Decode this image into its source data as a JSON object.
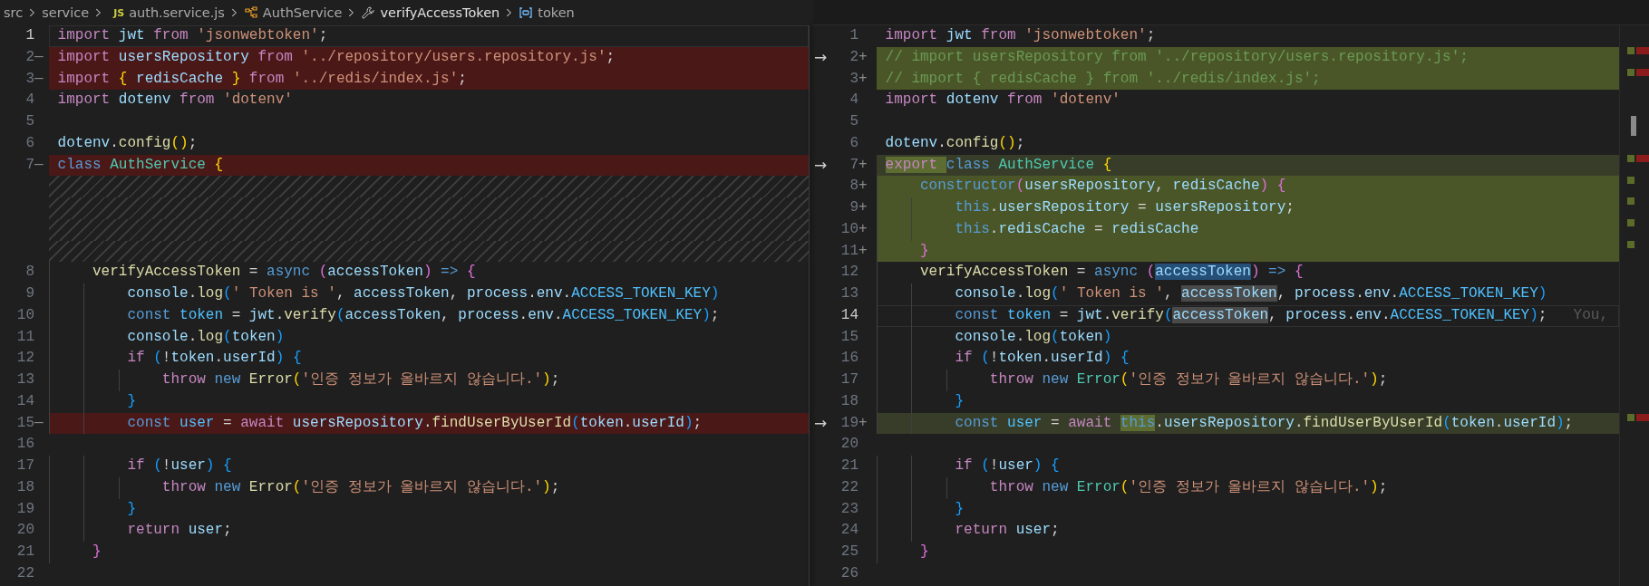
{
  "breadcrumb": [
    {
      "kind": "folder",
      "text": "src"
    },
    {
      "kind": "folder",
      "text": "service"
    },
    {
      "kind": "file",
      "badge": "JS",
      "text": "auth.service.js"
    },
    {
      "kind": "class",
      "text": "AuthService"
    },
    {
      "kind": "method",
      "text": "verifyAccessToken"
    },
    {
      "kind": "variable",
      "text": "token"
    }
  ],
  "panes": [
    {
      "kind": "original",
      "lines": [
        {
          "number": "1",
          "kind": "none",
          "current": true,
          "tokens": [
            {
              "text": "import ",
              "kind": "keyword"
            },
            {
              "text": "jwt ",
              "kind": "variable"
            },
            {
              "text": "from ",
              "kind": "keyword"
            },
            {
              "text": "'jsonwebtoken'",
              "kind": "string"
            },
            {
              "text": ";",
              "kind": "plain"
            }
          ]
        },
        {
          "number": "2",
          "marker": "—",
          "kind": "removed",
          "current": false,
          "tokens": [
            {
              "text": "import ",
              "kind": "keyword"
            },
            {
              "text": "usersRepository ",
              "kind": "variable"
            },
            {
              "text": "from ",
              "kind": "keyword"
            },
            {
              "text": "'../repository/users.repository.js'",
              "kind": "string"
            },
            {
              "text": ";",
              "kind": "plain"
            }
          ]
        },
        {
          "number": "3",
          "marker": "—",
          "kind": "removed",
          "current": false,
          "tokens": [
            {
              "text": "import ",
              "kind": "keyword"
            },
            {
              "text": "{ ",
              "kind": "bracket1"
            },
            {
              "text": "redisCache ",
              "kind": "variable"
            },
            {
              "text": "} ",
              "kind": "bracket1"
            },
            {
              "text": "from ",
              "kind": "keyword"
            },
            {
              "text": "'../redis/index.js'",
              "kind": "string"
            },
            {
              "text": ";",
              "kind": "plain"
            }
          ]
        },
        {
          "number": "4",
          "kind": "none",
          "current": false,
          "tokens": [
            {
              "text": "import ",
              "kind": "keyword"
            },
            {
              "text": "dotenv ",
              "kind": "variable"
            },
            {
              "text": "from ",
              "kind": "keyword"
            },
            {
              "text": "'dotenv'",
              "kind": "string"
            }
          ]
        },
        {
          "number": "5",
          "kind": "none",
          "current": false
        },
        {
          "number": "6",
          "kind": "none",
          "current": false,
          "tokens": [
            {
              "text": "dotenv",
              "kind": "variable"
            },
            {
              "text": ".",
              "kind": "plain"
            },
            {
              "text": "config",
              "kind": "function"
            },
            {
              "text": "()",
              "kind": "bracket1"
            },
            {
              "text": ";",
              "kind": "plain"
            }
          ]
        },
        {
          "number": "7",
          "marker": "—",
          "kind": "removed",
          "current": false,
          "tokens": [
            {
              "text": "class ",
              "kind": "storage"
            },
            {
              "text": "AuthService ",
              "kind": "type"
            },
            {
              "text": "{",
              "kind": "bracket1"
            }
          ]
        },
        {
          "kind": "filler"
        },
        {
          "kind": "filler"
        },
        {
          "kind": "filler"
        },
        {
          "kind": "filler"
        },
        {
          "number": "8",
          "kind": "none",
          "current": false,
          "tokens": [
            {
              "text": "    verifyAccessToken ",
              "kind": "function"
            },
            {
              "text": "= ",
              "kind": "plain"
            },
            {
              "text": "async ",
              "kind": "storage"
            },
            {
              "text": "(",
              "kind": "bracket2"
            },
            {
              "text": "accessToken",
              "kind": "variable"
            },
            {
              "text": ") ",
              "kind": "bracket2"
            },
            {
              "text": "=> ",
              "kind": "storage"
            },
            {
              "text": "{",
              "kind": "bracket2"
            }
          ]
        },
        {
          "number": "9",
          "kind": "none",
          "current": false,
          "tokens": [
            {
              "text": "        console",
              "kind": "variable"
            },
            {
              "text": ".",
              "kind": "plain"
            },
            {
              "text": "log",
              "kind": "function"
            },
            {
              "text": "(",
              "kind": "bracket3"
            },
            {
              "text": "' Token is '",
              "kind": "string"
            },
            {
              "text": ", ",
              "kind": "plain"
            },
            {
              "text": "accessToken",
              "kind": "variable"
            },
            {
              "text": ", ",
              "kind": "plain"
            },
            {
              "text": "process",
              "kind": "variable"
            },
            {
              "text": ".",
              "kind": "plain"
            },
            {
              "text": "env",
              "kind": "variable"
            },
            {
              "text": ".",
              "kind": "plain"
            },
            {
              "text": "ACCESS_TOKEN_KEY",
              "kind": "constant"
            },
            {
              "text": ")",
              "kind": "bracket3"
            }
          ]
        },
        {
          "number": "10",
          "kind": "none",
          "current": false,
          "tokens": [
            {
              "text": "        const ",
              "kind": "storage"
            },
            {
              "text": "token ",
              "kind": "constant"
            },
            {
              "text": "= ",
              "kind": "plain"
            },
            {
              "text": "jwt",
              "kind": "variable"
            },
            {
              "text": ".",
              "kind": "plain"
            },
            {
              "text": "verify",
              "kind": "function"
            },
            {
              "text": "(",
              "kind": "bracket3"
            },
            {
              "text": "accessToken",
              "kind": "variable"
            },
            {
              "text": ", ",
              "kind": "plain"
            },
            {
              "text": "process",
              "kind": "variable"
            },
            {
              "text": ".",
              "kind": "plain"
            },
            {
              "text": "env",
              "kind": "variable"
            },
            {
              "text": ".",
              "kind": "plain"
            },
            {
              "text": "ACCESS_TOKEN_KEY",
              "kind": "constant"
            },
            {
              "text": ")",
              "kind": "bracket3"
            },
            {
              "text": ";",
              "kind": "plain"
            }
          ]
        },
        {
          "number": "11",
          "kind": "none",
          "current": false,
          "tokens": [
            {
              "text": "        console",
              "kind": "variable"
            },
            {
              "text": ".",
              "kind": "plain"
            },
            {
              "text": "log",
              "kind": "function"
            },
            {
              "text": "(",
              "kind": "bracket3"
            },
            {
              "text": "token",
              "kind": "variable"
            },
            {
              "text": ")",
              "kind": "bracket3"
            }
          ]
        },
        {
          "number": "12",
          "kind": "none",
          "current": false,
          "tokens": [
            {
              "text": "        if ",
              "kind": "keyword"
            },
            {
              "text": "(",
              "kind": "bracket3"
            },
            {
              "text": "!",
              "kind": "plain"
            },
            {
              "text": "token",
              "kind": "variable"
            },
            {
              "text": ".",
              "kind": "plain"
            },
            {
              "text": "userId",
              "kind": "variable"
            },
            {
              "text": ") ",
              "kind": "bracket3"
            },
            {
              "text": "{",
              "kind": "bracket3"
            }
          ]
        },
        {
          "number": "13",
          "kind": "none",
          "current": false,
          "tokens": [
            {
              "text": "            throw ",
              "kind": "keyword"
            },
            {
              "text": "new ",
              "kind": "storage"
            },
            {
              "text": "Error",
              "kind": "function"
            },
            {
              "text": "(",
              "kind": "bracket1"
            },
            {
              "text": "'인증 정보가 올바르지 않습니다.'",
              "kind": "string"
            },
            {
              "text": ")",
              "kind": "bracket1"
            },
            {
              "text": ";",
              "kind": "plain"
            }
          ]
        },
        {
          "number": "14",
          "kind": "none",
          "current": false,
          "tokens": [
            {
              "text": "        }",
              "kind": "bracket3"
            }
          ]
        },
        {
          "number": "15",
          "marker": "—",
          "kind": "removed",
          "current": false,
          "tokens": [
            {
              "text": "        const ",
              "kind": "storage"
            },
            {
              "text": "user ",
              "kind": "constant"
            },
            {
              "text": "= ",
              "kind": "plain"
            },
            {
              "text": "await ",
              "kind": "keyword"
            },
            {
              "text": "usersRepository",
              "kind": "variable"
            },
            {
              "text": ".",
              "kind": "plain"
            },
            {
              "text": "findUserByUserId",
              "kind": "function"
            },
            {
              "text": "(",
              "kind": "bracket3"
            },
            {
              "text": "token",
              "kind": "variable"
            },
            {
              "text": ".",
              "kind": "plain"
            },
            {
              "text": "userId",
              "kind": "variable"
            },
            {
              "text": ")",
              "kind": "bracket3"
            },
            {
              "text": ";",
              "kind": "plain"
            }
          ]
        },
        {
          "number": "16",
          "kind": "none",
          "current": false
        },
        {
          "number": "17",
          "kind": "none",
          "current": false,
          "tokens": [
            {
              "text": "        if ",
              "kind": "keyword"
            },
            {
              "text": "(",
              "kind": "bracket3"
            },
            {
              "text": "!",
              "kind": "plain"
            },
            {
              "text": "user",
              "kind": "variable"
            },
            {
              "text": ") ",
              "kind": "bracket3"
            },
            {
              "text": "{",
              "kind": "bracket3"
            }
          ]
        },
        {
          "number": "18",
          "kind": "none",
          "current": false,
          "tokens": [
            {
              "text": "            throw ",
              "kind": "keyword"
            },
            {
              "text": "new ",
              "kind": "storage"
            },
            {
              "text": "Error",
              "kind": "function"
            },
            {
              "text": "(",
              "kind": "bracket1"
            },
            {
              "text": "'인증 정보가 올바르지 않습니다.'",
              "kind": "string"
            },
            {
              "text": ")",
              "kind": "bracket1"
            },
            {
              "text": ";",
              "kind": "plain"
            }
          ]
        },
        {
          "number": "19",
          "kind": "none",
          "current": false,
          "tokens": [
            {
              "text": "        }",
              "kind": "bracket3"
            }
          ]
        },
        {
          "number": "20",
          "kind": "none",
          "current": false,
          "tokens": [
            {
              "text": "        return ",
              "kind": "keyword"
            },
            {
              "text": "user",
              "kind": "variable"
            },
            {
              "text": ";",
              "kind": "plain"
            }
          ]
        },
        {
          "number": "21",
          "kind": "none",
          "current": false,
          "tokens": [
            {
              "text": "    }",
              "kind": "bracket2"
            }
          ]
        },
        {
          "number": "22",
          "kind": "none",
          "current": false
        }
      ]
    },
    {
      "kind": "modified",
      "lines": [
        {
          "number": "1",
          "kind": "none",
          "current": false,
          "tokens": [
            {
              "text": "import ",
              "kind": "keyword"
            },
            {
              "text": "jwt ",
              "kind": "variable"
            },
            {
              "text": "from ",
              "kind": "keyword"
            },
            {
              "text": "'jsonwebtoken'",
              "kind": "string"
            },
            {
              "text": ";",
              "kind": "plain"
            }
          ]
        },
        {
          "number": "2",
          "marker": "+",
          "arrow": "→",
          "kind": "added",
          "current": false,
          "tokens": [
            {
              "text": "// import usersRepository from '../repository/users.repository.js';",
              "kind": "comment"
            }
          ]
        },
        {
          "number": "3",
          "marker": "+",
          "kind": "added",
          "current": false,
          "tokens": [
            {
              "text": "// import { redisCache } from '../redis/index.js';",
              "kind": "comment"
            }
          ]
        },
        {
          "number": "4",
          "kind": "none",
          "current": false,
          "tokens": [
            {
              "text": "import ",
              "kind": "keyword"
            },
            {
              "text": "dotenv ",
              "kind": "variable"
            },
            {
              "text": "from ",
              "kind": "keyword"
            },
            {
              "text": "'dotenv'",
              "kind": "string"
            }
          ]
        },
        {
          "number": "5",
          "kind": "none",
          "current": false
        },
        {
          "number": "6",
          "kind": "none",
          "current": false,
          "tokens": [
            {
              "text": "dotenv",
              "kind": "variable"
            },
            {
              "text": ".",
              "kind": "plain"
            },
            {
              "text": "config",
              "kind": "function"
            },
            {
              "text": "()",
              "kind": "bracket1"
            },
            {
              "text": ";",
              "kind": "plain"
            }
          ]
        },
        {
          "number": "7",
          "marker": "+",
          "arrow": "→",
          "kind": "changed",
          "current": false,
          "tokens": [
            {
              "text": "export ",
              "kind": "keyword",
              "inserted": true
            },
            {
              "text": "class ",
              "kind": "storage"
            },
            {
              "text": "AuthService ",
              "kind": "type"
            },
            {
              "text": "{",
              "kind": "bracket1"
            }
          ]
        },
        {
          "number": "8",
          "marker": "+",
          "kind": "added",
          "current": false,
          "tokens": [
            {
              "text": "    constructor",
              "kind": "storage"
            },
            {
              "text": "(",
              "kind": "bracket2"
            },
            {
              "text": "usersRepository",
              "kind": "variable"
            },
            {
              "text": ", ",
              "kind": "plain"
            },
            {
              "text": "redisCache",
              "kind": "variable"
            },
            {
              "text": ") ",
              "kind": "bracket2"
            },
            {
              "text": "{",
              "kind": "bracket2"
            }
          ]
        },
        {
          "number": "9",
          "marker": "+",
          "kind": "added",
          "current": false,
          "tokens": [
            {
              "text": "        this",
              "kind": "storage"
            },
            {
              "text": ".",
              "kind": "plain"
            },
            {
              "text": "usersRepository ",
              "kind": "variable"
            },
            {
              "text": "= ",
              "kind": "plain"
            },
            {
              "text": "usersRepository",
              "kind": "variable"
            },
            {
              "text": ";",
              "kind": "plain"
            }
          ]
        },
        {
          "number": "10",
          "marker": "+",
          "kind": "added",
          "current": false,
          "tokens": [
            {
              "text": "        this",
              "kind": "storage"
            },
            {
              "text": ".",
              "kind": "plain"
            },
            {
              "text": "redisCache ",
              "kind": "variable"
            },
            {
              "text": "= ",
              "kind": "plain"
            },
            {
              "text": "redisCache",
              "kind": "variable"
            }
          ]
        },
        {
          "number": "11",
          "marker": "+",
          "kind": "added",
          "current": false,
          "tokens": [
            {
              "text": "    }",
              "kind": "bracket2"
            }
          ]
        },
        {
          "number": "12",
          "kind": "none",
          "current": false,
          "tokens": [
            {
              "text": "    verifyAccessToken ",
              "kind": "function"
            },
            {
              "text": "= ",
              "kind": "plain"
            },
            {
              "text": "async ",
              "kind": "storage"
            },
            {
              "text": "(",
              "kind": "bracket2"
            },
            {
              "text": "accessToken",
              "kind": "variable",
              "selected": true
            },
            {
              "text": ") ",
              "kind": "bracket2"
            },
            {
              "text": "=> ",
              "kind": "storage"
            },
            {
              "text": "{",
              "kind": "bracket2"
            }
          ]
        },
        {
          "number": "13",
          "kind": "none",
          "current": false,
          "tokens": [
            {
              "text": "        console",
              "kind": "variable"
            },
            {
              "text": ".",
              "kind": "plain"
            },
            {
              "text": "log",
              "kind": "function"
            },
            {
              "text": "(",
              "kind": "bracket3"
            },
            {
              "text": "' Token is '",
              "kind": "string"
            },
            {
              "text": ", ",
              "kind": "plain"
            },
            {
              "text": "accessToken",
              "kind": "variable",
              "highlighted": true
            },
            {
              "text": ", ",
              "kind": "plain"
            },
            {
              "text": "process",
              "kind": "variable"
            },
            {
              "text": ".",
              "kind": "plain"
            },
            {
              "text": "env",
              "kind": "variable"
            },
            {
              "text": ".",
              "kind": "plain"
            },
            {
              "text": "ACCESS_TOKEN_KEY",
              "kind": "constant"
            },
            {
              "text": ")",
              "kind": "bracket3"
            }
          ]
        },
        {
          "number": "14",
          "kind": "none",
          "current": true,
          "blame": "You,",
          "tokens": [
            {
              "text": "        const ",
              "kind": "storage"
            },
            {
              "text": "token ",
              "kind": "constant"
            },
            {
              "text": "= ",
              "kind": "plain"
            },
            {
              "text": "jwt",
              "kind": "variable"
            },
            {
              "text": ".",
              "kind": "plain"
            },
            {
              "text": "verify",
              "kind": "function"
            },
            {
              "text": "(",
              "kind": "bracket3"
            },
            {
              "text": "accessToken",
              "kind": "variable",
              "highlighted": true
            },
            {
              "text": ", ",
              "kind": "plain"
            },
            {
              "text": "process",
              "kind": "variable"
            },
            {
              "text": ".",
              "kind": "plain"
            },
            {
              "text": "env",
              "kind": "variable"
            },
            {
              "text": ".",
              "kind": "plain"
            },
            {
              "text": "ACCESS_TOKEN_KEY",
              "kind": "constant"
            },
            {
              "text": ")",
              "kind": "bracket3"
            },
            {
              "text": ";",
              "kind": "plain"
            }
          ]
        },
        {
          "number": "15",
          "kind": "none",
          "current": false,
          "tokens": [
            {
              "text": "        console",
              "kind": "variable"
            },
            {
              "text": ".",
              "kind": "plain"
            },
            {
              "text": "log",
              "kind": "function"
            },
            {
              "text": "(",
              "kind": "bracket3"
            },
            {
              "text": "token",
              "kind": "variable"
            },
            {
              "text": ")",
              "kind": "bracket3"
            }
          ]
        },
        {
          "number": "16",
          "kind": "none",
          "current": false,
          "tokens": [
            {
              "text": "        if ",
              "kind": "keyword"
            },
            {
              "text": "(",
              "kind": "bracket3"
            },
            {
              "text": "!",
              "kind": "plain"
            },
            {
              "text": "token",
              "kind": "variable"
            },
            {
              "text": ".",
              "kind": "plain"
            },
            {
              "text": "userId",
              "kind": "variable"
            },
            {
              "text": ") ",
              "kind": "bracket3"
            },
            {
              "text": "{",
              "kind": "bracket3"
            }
          ]
        },
        {
          "number": "17",
          "kind": "none",
          "current": false,
          "tokens": [
            {
              "text": "            throw ",
              "kind": "keyword"
            },
            {
              "text": "new ",
              "kind": "storage"
            },
            {
              "text": "Error",
              "kind": "type"
            },
            {
              "text": "(",
              "kind": "bracket1"
            },
            {
              "text": "'인증 정보가 올바르지 않습니다.'",
              "kind": "string"
            },
            {
              "text": ")",
              "kind": "bracket1"
            },
            {
              "text": ";",
              "kind": "plain"
            }
          ]
        },
        {
          "number": "18",
          "kind": "none",
          "current": false,
          "tokens": [
            {
              "text": "        }",
              "kind": "bracket3"
            }
          ]
        },
        {
          "number": "19",
          "marker": "+",
          "arrow": "→",
          "kind": "changed",
          "current": false,
          "tokens": [
            {
              "text": "        const ",
              "kind": "storage"
            },
            {
              "text": "user ",
              "kind": "constant"
            },
            {
              "text": "= ",
              "kind": "plain"
            },
            {
              "text": "await ",
              "kind": "keyword"
            },
            {
              "text": "this",
              "kind": "storage",
              "inserted": true
            },
            {
              "text": ".",
              "kind": "plain"
            },
            {
              "text": "usersRepository",
              "kind": "variable"
            },
            {
              "text": ".",
              "kind": "plain"
            },
            {
              "text": "findUserByUserId",
              "kind": "function"
            },
            {
              "text": "(",
              "kind": "bracket3"
            },
            {
              "text": "token",
              "kind": "variable"
            },
            {
              "text": ".",
              "kind": "plain"
            },
            {
              "text": "userId",
              "kind": "variable"
            },
            {
              "text": ")",
              "kind": "bracket3"
            },
            {
              "text": ";",
              "kind": "plain"
            }
          ]
        },
        {
          "number": "20",
          "kind": "none",
          "current": false
        },
        {
          "number": "21",
          "kind": "none",
          "current": false,
          "tokens": [
            {
              "text": "        if ",
              "kind": "keyword"
            },
            {
              "text": "(",
              "kind": "bracket3"
            },
            {
              "text": "!",
              "kind": "plain"
            },
            {
              "text": "user",
              "kind": "variable"
            },
            {
              "text": ") ",
              "kind": "bracket3"
            },
            {
              "text": "{",
              "kind": "bracket3"
            }
          ]
        },
        {
          "number": "22",
          "kind": "none",
          "current": false,
          "tokens": [
            {
              "text": "            throw ",
              "kind": "keyword"
            },
            {
              "text": "new ",
              "kind": "storage"
            },
            {
              "text": "Error",
              "kind": "type"
            },
            {
              "text": "(",
              "kind": "bracket1"
            },
            {
              "text": "'인증 정보가 올바르지 않습니다.'",
              "kind": "string"
            },
            {
              "text": ")",
              "kind": "bracket1"
            },
            {
              "text": ";",
              "kind": "plain"
            }
          ]
        },
        {
          "number": "23",
          "kind": "none",
          "current": false,
          "tokens": [
            {
              "text": "        }",
              "kind": "bracket3"
            }
          ]
        },
        {
          "number": "24",
          "kind": "none",
          "current": false,
          "tokens": [
            {
              "text": "        return ",
              "kind": "keyword"
            },
            {
              "text": "user",
              "kind": "variable"
            },
            {
              "text": ";",
              "kind": "plain"
            }
          ]
        },
        {
          "number": "25",
          "kind": "none",
          "current": false,
          "tokens": [
            {
              "text": "    }",
              "kind": "bracket2"
            }
          ]
        },
        {
          "number": "26",
          "kind": "none",
          "current": false
        }
      ]
    }
  ]
}
